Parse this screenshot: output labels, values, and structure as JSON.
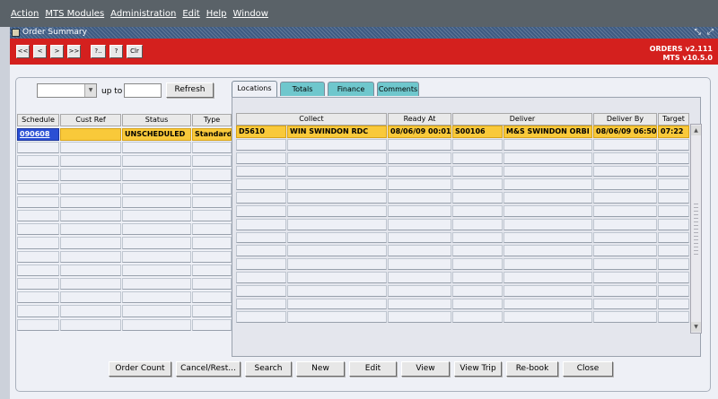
{
  "menu": [
    "Action",
    "MTS Modules",
    "Administration",
    "Edit",
    "Help",
    "Window"
  ],
  "window": {
    "title": "Order Summary",
    "controls": "⤡ ⤢"
  },
  "toolbar": {
    "buttons": [
      "<<",
      "<",
      ">",
      ">>",
      "?..",
      "?",
      "Clr"
    ]
  },
  "version": {
    "line1": "ORDERS v2.111",
    "line2": "MTS v10.5.0"
  },
  "filter": {
    "combo_value": "",
    "upto_label": "up to",
    "upto_value": "",
    "refresh": "Refresh"
  },
  "left_table": {
    "headers": [
      "Schedule",
      "Cust Ref",
      "Status",
      "Type"
    ],
    "row": {
      "schedule": "090608",
      "cust_ref": "",
      "status": "UNSCHEDULED",
      "type": "Standard"
    }
  },
  "tabs": [
    "Locations",
    "Totals",
    "Finance",
    "Comments"
  ],
  "right_table": {
    "headers": [
      "Collect",
      "Ready At",
      "Deliver",
      "Deliver By",
      "Target"
    ],
    "row": {
      "collect_code": "D5610",
      "collect_name": "WIN SWINDON RDC",
      "ready_at": "08/06/09 00:01",
      "deliver_code": "S00106",
      "deliver_name": "M&S SWINDON ORBI",
      "deliver_by": "08/06/09 06:50",
      "target": "07:22"
    }
  },
  "actions": [
    "Order Count",
    "Cancel/Rest...",
    "Search",
    "New",
    "Edit",
    "View",
    "View Trip",
    "Re-book",
    "Close"
  ],
  "colors": {
    "menubar": "#5a6268",
    "redbar": "#d4201e",
    "selected_row": "#f9c93a",
    "tab_inactive": "#6fc7cd"
  }
}
